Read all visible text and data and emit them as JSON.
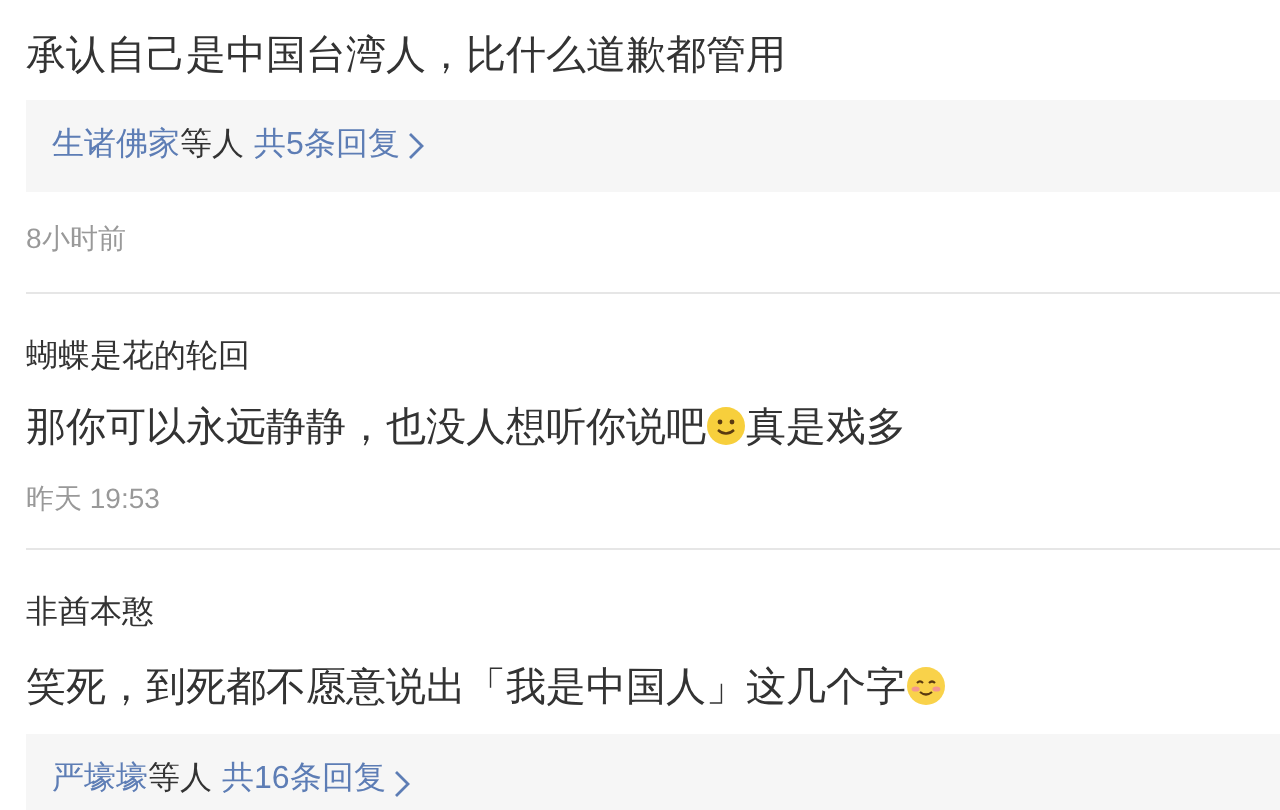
{
  "comments": [
    {
      "content": [
        {
          "kind": "text",
          "text": "承认自己是中国台湾人，比什么道歉都管用"
        }
      ],
      "replies": {
        "names": "生诸佛家",
        "suffix": "等人",
        "count": "共5条回复"
      },
      "time": "8小时前"
    },
    {
      "author": "蝴蝶是花的轮回",
      "content": [
        {
          "kind": "text",
          "text": "那你可以永远静静，也没人想听你说吧"
        },
        {
          "kind": "smile"
        },
        {
          "kind": "text",
          "text": "真是戏多"
        }
      ],
      "time": "昨天 19:53"
    },
    {
      "author": "非酋本憨",
      "content": [
        {
          "kind": "text",
          "text": "笑死，到死都不愿意说出「我是中国人」这几个字"
        },
        {
          "kind": "blush"
        }
      ],
      "replies": {
        "names": "严壕壕",
        "suffix": "等人",
        "count": "共16条回复"
      }
    }
  ]
}
